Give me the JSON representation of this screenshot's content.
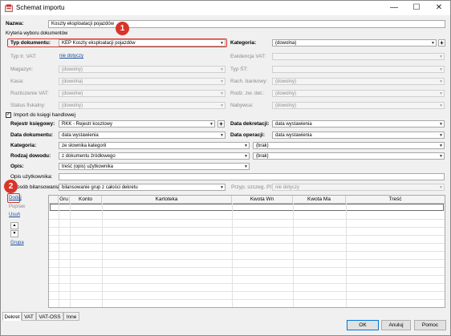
{
  "window": {
    "title": "Schemat importu"
  },
  "nazwa": {
    "label": "Nazwa:",
    "value": "Koszty eksploatacji pojazdów"
  },
  "kryteria": {
    "label": "Kryteria wyboru dokumentów"
  },
  "typ_dokumentu": {
    "label": "Typ dokumentu:",
    "value": "KEP Koszty eksploatacji pojazdów"
  },
  "kategoria_top": {
    "label": "Kategoria:",
    "value": "(dowolna)"
  },
  "typ_vat": {
    "label": "Typ tr. VAT:",
    "value": "nie dotyczy"
  },
  "ewidencja_vat": {
    "label": "Ewidencja VAT:",
    "value": ""
  },
  "magazyn": {
    "label": "Magazyn:",
    "value": "(dowolny)"
  },
  "typ_st": {
    "label": "Typ ŚT:",
    "value": ""
  },
  "kasa": {
    "label": "Kasa:",
    "value": "(dowolna)"
  },
  "rach_bankowy": {
    "label": "Rach. bankowy:",
    "value": "(dowolny)"
  },
  "rozliczenie_vat": {
    "label": "Rozliczenie VAT:",
    "value": "(dowolne)"
  },
  "rodz_zw_det": {
    "label": "Rodz. zw. det.:",
    "value": "(dowolny)"
  },
  "status_fiskalny": {
    "label": "Status fiskalny:",
    "value": "(dowolny)"
  },
  "nabywca": {
    "label": "Nabywca:",
    "value": "(dowolny)"
  },
  "import_check": {
    "label": "Import do księgi handlowej",
    "checked": "✓"
  },
  "rejestr": {
    "label": "Rejestr księgowy:",
    "value": "RKK - Rejestr kosztowy"
  },
  "data_dekretacji": {
    "label": "Data dekretacji:",
    "value": "data wystawienia"
  },
  "data_dokumentu": {
    "label": "Data dokumentu:",
    "value": "data wystawienia"
  },
  "data_operacji": {
    "label": "Data operacji:",
    "value": "data wystawienia"
  },
  "kategoria": {
    "label": "Kategoria:",
    "value": "ze słownika kategorii",
    "right_value": "(brak)"
  },
  "rodzaj_dowodu": {
    "label": "Rodzaj dowodu:",
    "value": "z dokumentu źródłowego",
    "right_value": "(brak)"
  },
  "opis": {
    "label": "Opis:",
    "value": "treść (opis) użytkownika"
  },
  "opis_uzytkownika": {
    "label": "Opis użytkownika:",
    "value": ""
  },
  "bilansowanie": {
    "label": "Sposób bilansowania:",
    "value": "bilansowanie grup z całości dekretu"
  },
  "przyp_pit": {
    "label": "Przyp. szczeg. PIT:",
    "value": "nie dotyczy"
  },
  "side_actions": {
    "dodaj": "Dodaj",
    "popraw": "Popraw",
    "usun": "Usuń",
    "up": "▲",
    "down": "▼",
    "grupa": "Grupa"
  },
  "grid": {
    "columns": [
      "Gru",
      "Konto",
      "Kartoteka",
      "Kwota Wn",
      "Kwota Ma",
      "Treść"
    ]
  },
  "tabs": [
    "Dekret",
    "VAT",
    "VAT-OSS",
    "Inne"
  ],
  "buttons": {
    "ok": "OK",
    "cancel": "Anuluj",
    "help": "Pomoc"
  },
  "badges": {
    "one": "1",
    "two": "2"
  },
  "window_controls": {
    "minimize": "—",
    "maximize": "☐",
    "close": "✕"
  },
  "colors": {
    "highlight": "#d8342a",
    "link": "#1a4f9e"
  }
}
